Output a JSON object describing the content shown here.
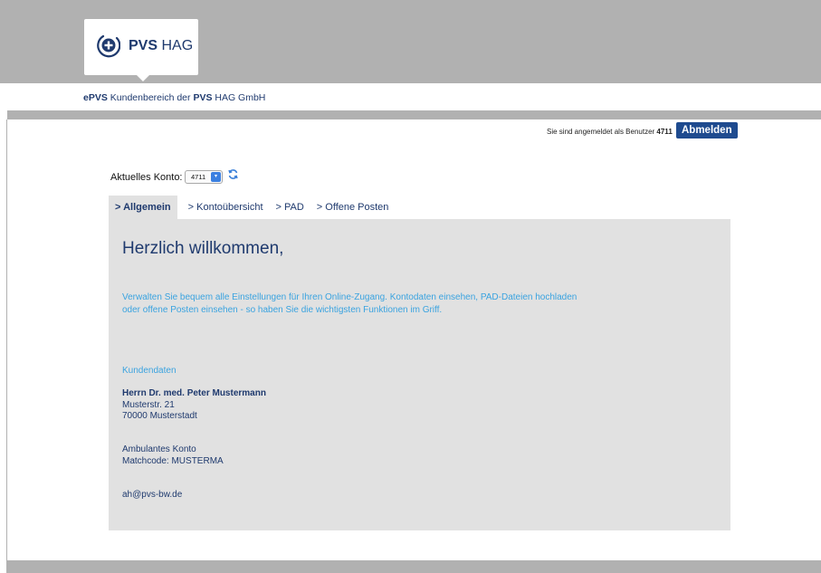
{
  "header": {
    "logo_bold": "PVS",
    "logo_rest": " HAG",
    "subtitle_epvs": "ePVS",
    "subtitle_mid": " Kundenbereich der ",
    "subtitle_pvs": "PVS",
    "subtitle_end": " HAG GmbH"
  },
  "session": {
    "login_text": "Sie sind angemeldet als Benutzer ",
    "user_id": "4711",
    "logout_label": "Abmelden"
  },
  "account": {
    "label": "Aktuelles Konto:",
    "selected": "4711"
  },
  "tabs": [
    {
      "label": "> Allgemein",
      "active": true
    },
    {
      "label": "> Kontoübersicht",
      "active": false
    },
    {
      "label": "> PAD",
      "active": false
    },
    {
      "label": "> Offene Posten",
      "active": false
    }
  ],
  "main": {
    "welcome": "Herzlich willkommen,",
    "intro_line1": "Verwalten Sie bequem alle Einstellungen für Ihren Online-Zugang. Kontodaten einsehen, PAD-Dateien hochladen",
    "intro_line2": "oder offene Posten einsehen - so haben Sie die wichtigsten Funktionen im Griff.",
    "section_title": "Kundendaten",
    "customer": {
      "name": "Herrn Dr. med. Peter Mustermann",
      "street": "Musterstr. 21",
      "city": "70000 Musterstadt",
      "account_type": "Ambulantes Konto",
      "matchcode": "Matchcode: MUSTERMA",
      "email": "ah@pvs-bw.de"
    }
  },
  "colors": {
    "brand_blue": "#1f3a6e",
    "accent_blue": "#3aa3e0",
    "button_blue": "#1f4b8f",
    "gray_bar": "#b1b1b1",
    "panel_gray": "#e1e1e1"
  },
  "icons": [
    "pvs-logo-icon",
    "select-arrow-icon",
    "refresh-icon"
  ]
}
